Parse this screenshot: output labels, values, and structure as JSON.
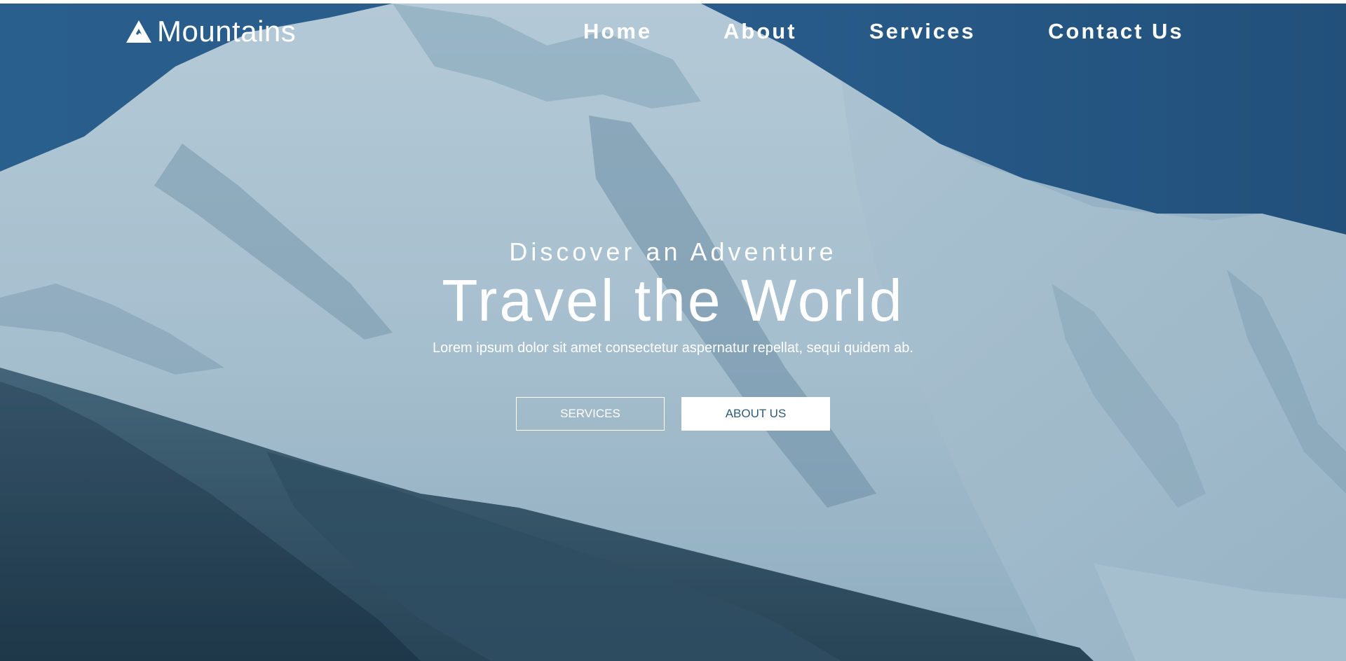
{
  "brand": {
    "icon": "mountain-icon",
    "name": "Mountains"
  },
  "nav": {
    "items": [
      {
        "label": "Home"
      },
      {
        "label": "About"
      },
      {
        "label": "Services"
      },
      {
        "label": "Contact Us"
      }
    ]
  },
  "hero": {
    "eyebrow": "Discover an Adventure",
    "headline": "Travel the World",
    "tagline": "Lorem ipsum dolor sit amet consectetur aspernatur repellat, sequi quidem ab.",
    "buttons": {
      "services_label": "SERVICES",
      "about_label": "ABOUT US"
    }
  },
  "colors": {
    "overlay": "#2f5f86",
    "sky": "#2b5f8e",
    "snow": "#c9dde6",
    "button_text": "#2e5a78",
    "white": "#ffffff"
  }
}
